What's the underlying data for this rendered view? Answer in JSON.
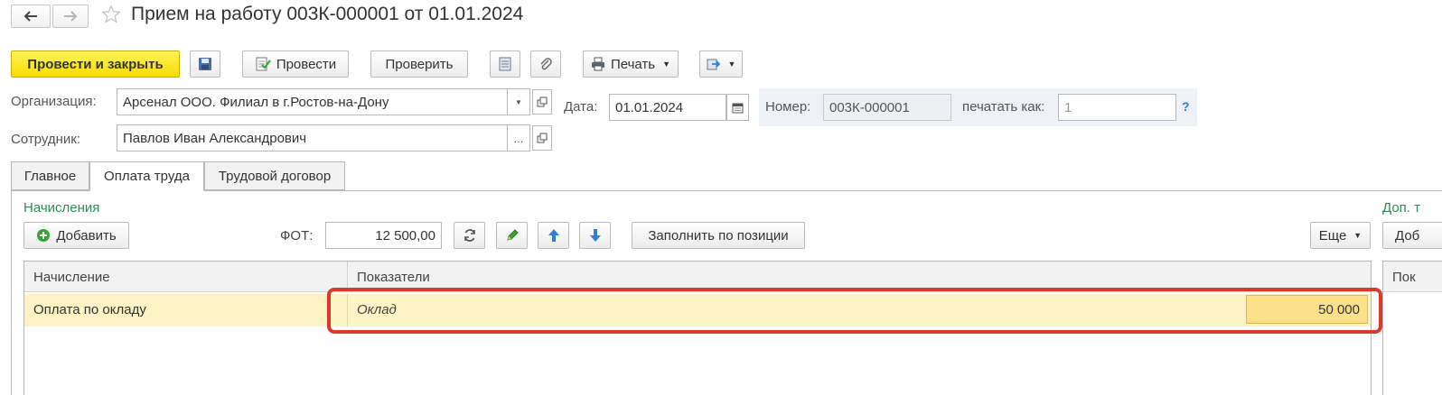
{
  "window": {
    "title": "Прием на работу 003К-000001 от 01.01.2024"
  },
  "toolbar": {
    "post_and_close": "Провести и закрыть",
    "post": "Провести",
    "check": "Проверить",
    "print": "Печать"
  },
  "form": {
    "organization_label": "Организация:",
    "organization_value": "Арсенал ООО. Филиал в г.Ростов-на-Дону",
    "employee_label": "Сотрудник:",
    "employee_value": "Павлов Иван Александрович",
    "employee_select": "...",
    "date_label": "Дата:",
    "date_value": "01.01.2024",
    "number_label": "Номер:",
    "number_value": "003К-000001",
    "print_as_label": "печатать как:",
    "print_as_placeholder": "1",
    "help": "?"
  },
  "tabs": [
    {
      "label": "Главное"
    },
    {
      "label": "Оплата труда"
    },
    {
      "label": "Трудовой договор"
    }
  ],
  "accruals": {
    "section_title": "Начисления",
    "add_button": "Добавить",
    "fot_label": "ФОТ:",
    "fot_value": "12 500,00",
    "fill_by_position": "Заполнить по позиции",
    "more": "Еще",
    "columns": {
      "accrual": "Начисление",
      "indicators": "Показатели"
    },
    "rows": [
      {
        "accrual": "Оплата по окладу",
        "indicator": "Оклад",
        "value": "50 000"
      }
    ]
  },
  "right_panel": {
    "title": "Доп. т",
    "add": "Доб",
    "column": "Пок"
  },
  "colors": {
    "primary_button": "#f7dc00",
    "section_title": "#2e8b57",
    "row_highlight": "#fdf3c4",
    "value_cell": "#fde08a",
    "annotation": "#d93a2b",
    "arrow_blue": "#2f7fd6"
  }
}
